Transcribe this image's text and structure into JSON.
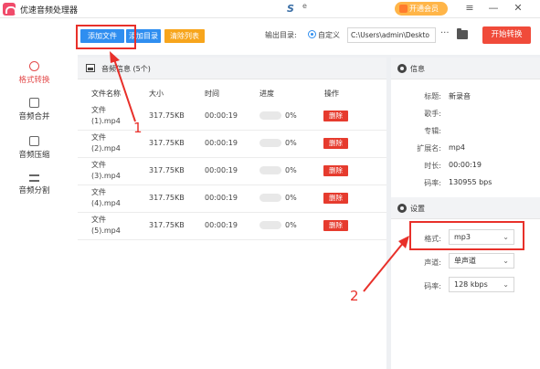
{
  "app": {
    "title": "优速音频处理器",
    "brand_letter": "S",
    "brand_extra": "e",
    "member_label": "开通会员"
  },
  "window_controls": {
    "menu": "≡",
    "minimize": "—",
    "close": "✕"
  },
  "toolbar": {
    "add_file_label": "添加文件",
    "add_dir_label": "添加目录",
    "clear_label": "清除列表",
    "output_label": "输出目录:",
    "custom_label": "自定义",
    "output_path": "C:\\Users\\admin\\Deskto",
    "more_label": "···",
    "start_label": "开始转换"
  },
  "sidebar": {
    "items": [
      {
        "label": "格式转换",
        "icon": "refresh-circle-icon",
        "active": true
      },
      {
        "label": "音频合并",
        "icon": "merge-icon",
        "active": false
      },
      {
        "label": "音频压缩",
        "icon": "compress-icon",
        "active": false
      },
      {
        "label": "音频分割",
        "icon": "split-icon",
        "active": false
      }
    ]
  },
  "file_panel": {
    "title": "音频信息 (5个)",
    "columns": [
      "文件名称",
      "大小",
      "时间",
      "进度",
      "操作"
    ],
    "rows": [
      {
        "name": "文件 (1).mp4",
        "size": "317.75KB",
        "time": "00:00:19",
        "progress": 0,
        "percent": "0%",
        "action": "删除"
      },
      {
        "name": "文件 (2).mp4",
        "size": "317.75KB",
        "time": "00:00:19",
        "progress": 0,
        "percent": "0%",
        "action": "删除"
      },
      {
        "name": "文件 (3).mp4",
        "size": "317.75KB",
        "time": "00:00:19",
        "progress": 0,
        "percent": "0%",
        "action": "删除"
      },
      {
        "name": "文件 (4).mp4",
        "size": "317.75KB",
        "time": "00:00:19",
        "progress": 0,
        "percent": "0%",
        "action": "删除"
      },
      {
        "name": "文件 (5).mp4",
        "size": "317.75KB",
        "time": "00:00:19",
        "progress": 0,
        "percent": "0%",
        "action": "删除"
      }
    ]
  },
  "info": {
    "title": "信息",
    "fields": [
      {
        "label": "标题:",
        "value": "新录音"
      },
      {
        "label": "歌手:",
        "value": ""
      },
      {
        "label": "专辑:",
        "value": ""
      },
      {
        "label": "扩展名:",
        "value": "mp4"
      },
      {
        "label": "时长:",
        "value": "00:00:19"
      },
      {
        "label": "码率:",
        "value": "130955 bps"
      }
    ]
  },
  "settings": {
    "title": "设置",
    "format_label": "格式:",
    "format_value": "mp3",
    "channel_label": "声道:",
    "channel_value": "单声道",
    "bitrate_label": "码率:",
    "bitrate_value": "128 kbps"
  },
  "annotations": {
    "label_1": "1",
    "label_2": "2"
  },
  "colors": {
    "accent_blue": "#2f8ef0",
    "accent_orange": "#f7a51c",
    "start_red": "#f04b3a",
    "delete_red": "#e63b2e",
    "annotation_red": "#e8302a",
    "member_gold": "#ffb548"
  }
}
